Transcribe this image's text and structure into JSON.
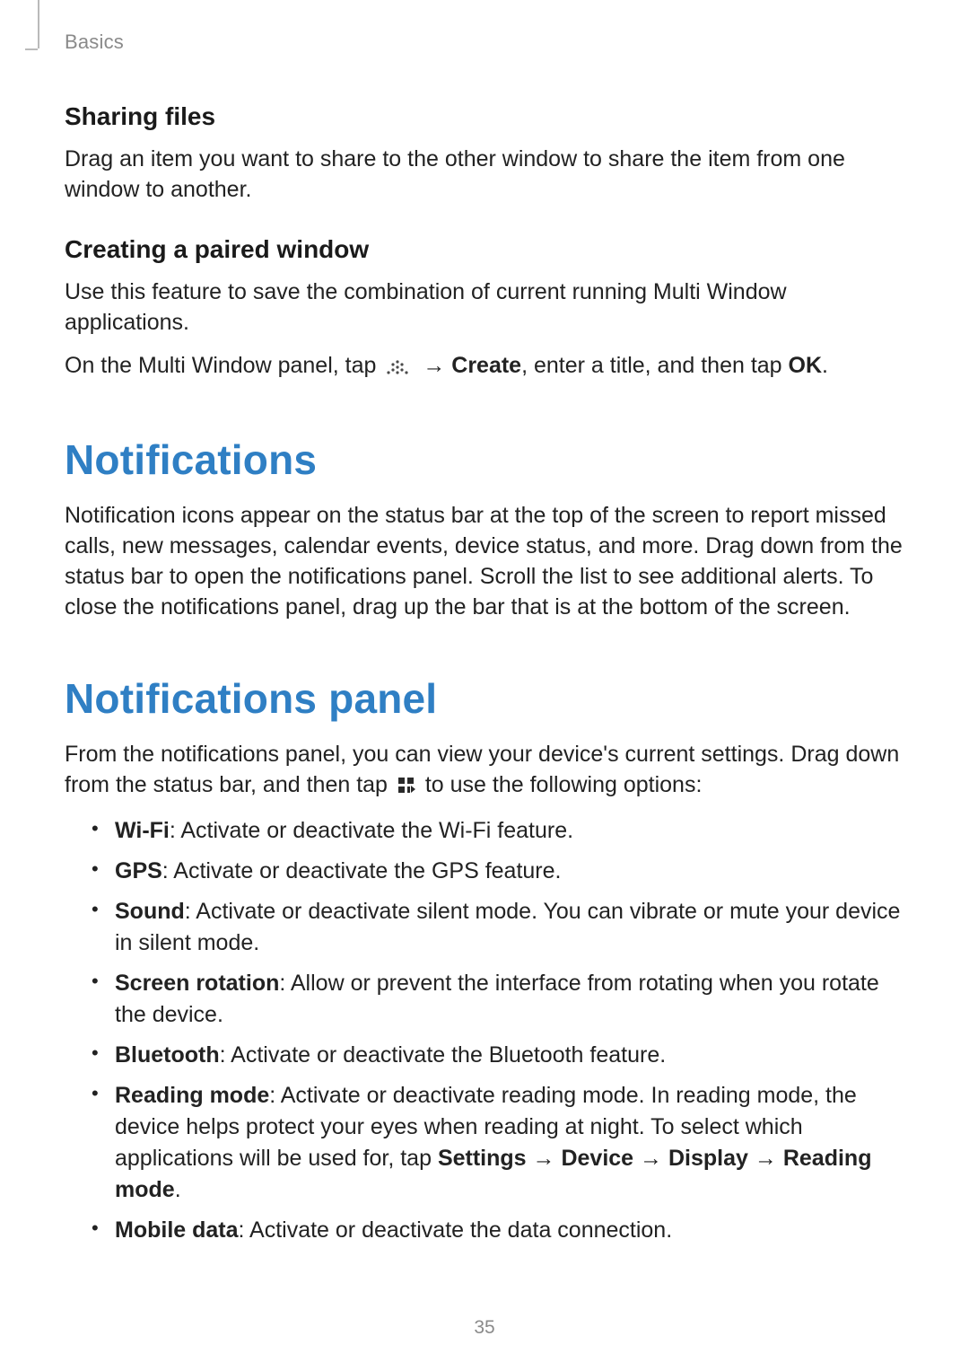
{
  "header": {
    "breadcrumb": "Basics"
  },
  "sharing": {
    "title": "Sharing files",
    "body": "Drag an item you want to share to the other window to share the item from one window to another."
  },
  "paired": {
    "title": "Creating a paired window",
    "body1": "Use this feature to save the combination of current running Multi Window applications.",
    "step_prefix": "On the Multi Window panel, tap ",
    "arrow": "→",
    "create_label": "Create",
    "step_mid": ", enter a title, and then tap ",
    "ok_label": "OK",
    "step_suffix": "."
  },
  "notifications": {
    "title": "Notifications",
    "body": "Notification icons appear on the status bar at the top of the screen to report missed calls, new messages, calendar events, device status, and more. Drag down from the status bar to open the notifications panel. Scroll the list to see additional alerts. To close the notifications panel, drag up the bar that is at the bottom of the screen."
  },
  "panel": {
    "title": "Notifications panel",
    "intro_prefix": "From the notifications panel, you can view your device's current settings. Drag down from the status bar, and then tap ",
    "intro_suffix": " to use the following options:",
    "options": [
      {
        "label": "Wi-Fi",
        "desc": ": Activate or deactivate the Wi-Fi feature."
      },
      {
        "label": "GPS",
        "desc": ": Activate or deactivate the GPS feature."
      },
      {
        "label": "Sound",
        "desc": ": Activate or deactivate silent mode. You can vibrate or mute your device in silent mode."
      },
      {
        "label": "Screen rotation",
        "desc": ": Allow or prevent the interface from rotating when you rotate the device."
      },
      {
        "label": "Bluetooth",
        "desc": ": Activate or deactivate the Bluetooth feature."
      },
      {
        "label": "Reading mode",
        "desc_prefix": ": Activate or deactivate reading mode. In reading mode, the device helps protect your eyes when reading at night. To select which applications will be used for, tap ",
        "path_settings": "Settings",
        "path_device": "Device",
        "path_display": "Display",
        "path_reading": "Reading mode",
        "desc_suffix": "."
      },
      {
        "label": "Mobile data",
        "desc": ": Activate or deactivate the data connection."
      }
    ]
  },
  "page_number": "35"
}
